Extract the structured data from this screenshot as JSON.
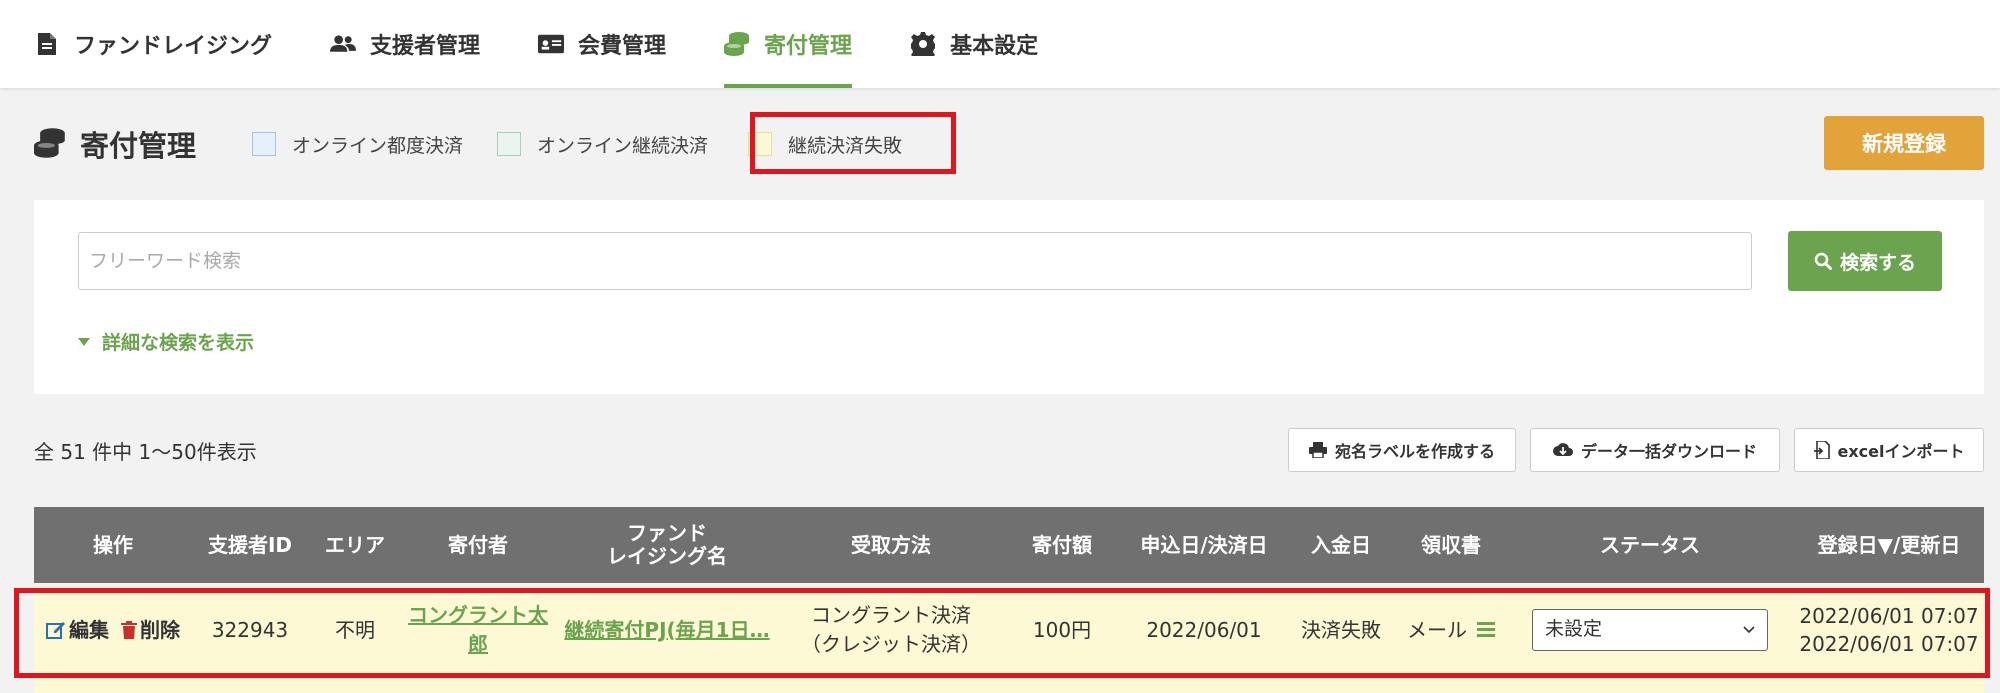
{
  "nav": {
    "items": [
      {
        "label": "ファンドレイジング",
        "icon": "document-icon"
      },
      {
        "label": "支援者管理",
        "icon": "users-icon"
      },
      {
        "label": "会費管理",
        "icon": "id-card-icon"
      },
      {
        "label": "寄付管理",
        "icon": "coins-icon",
        "active": true
      },
      {
        "label": "基本設定",
        "icon": "gear-icon"
      }
    ]
  },
  "colors": {
    "accent": "#6ba34e",
    "orange": "#e2a33b",
    "highlight": "#e0161f",
    "row_fail": "#fcf9d4",
    "header_bg": "#707070"
  },
  "page": {
    "title": "寄付管理",
    "legend": [
      {
        "label": "オンライン都度決済",
        "swatch_bg": "#e6f0f8",
        "swatch_border": "#a9c6de"
      },
      {
        "label": "オンライン継続決済",
        "swatch_bg": "#e9f5ee",
        "swatch_border": "#a9d1b6"
      },
      {
        "label": "継続決済失敗",
        "swatch_bg": "#fcf8d3",
        "swatch_border": "#e6de9a"
      }
    ],
    "new_button": "新規登録"
  },
  "search": {
    "placeholder": "フリーワード検索",
    "button": "検索する",
    "detail_toggle": "詳細な検索を表示"
  },
  "list": {
    "count_text": "全 51 件中 1〜50件表示",
    "actions": {
      "label_button": "宛名ラベルを作成する",
      "download_button": "データ一括ダウンロード",
      "import_button": "excelインポート"
    }
  },
  "table": {
    "headers": {
      "ops": "操作",
      "supporter_id": "支援者ID",
      "area": "エリア",
      "donor": "寄付者",
      "fund_line1": "ファンド",
      "fund_line2": "レイジング名",
      "method": "受取方法",
      "amount": "寄付額",
      "apply_date": "申込日/決済日",
      "payment_date": "入金日",
      "receipt": "領収書",
      "status": "ステータス",
      "dates": "登録日▼/更新日"
    },
    "row": {
      "edit": "編集",
      "delete": "削除",
      "supporter_id": "322943",
      "area": "不明",
      "donor_line1": "コングラント太",
      "donor_line2": "郎",
      "fund": "継続寄付PJ(毎月1日…",
      "method_line1": "コングラント決済",
      "method_line2": "（クレジット決済）",
      "amount": "100円",
      "apply_date": "2022/06/01",
      "payment_date": "決済失敗",
      "receipt": "メール",
      "status": "未設定",
      "registered": "2022/06/01 07:07",
      "updated": "2022/06/01 07:07"
    }
  }
}
